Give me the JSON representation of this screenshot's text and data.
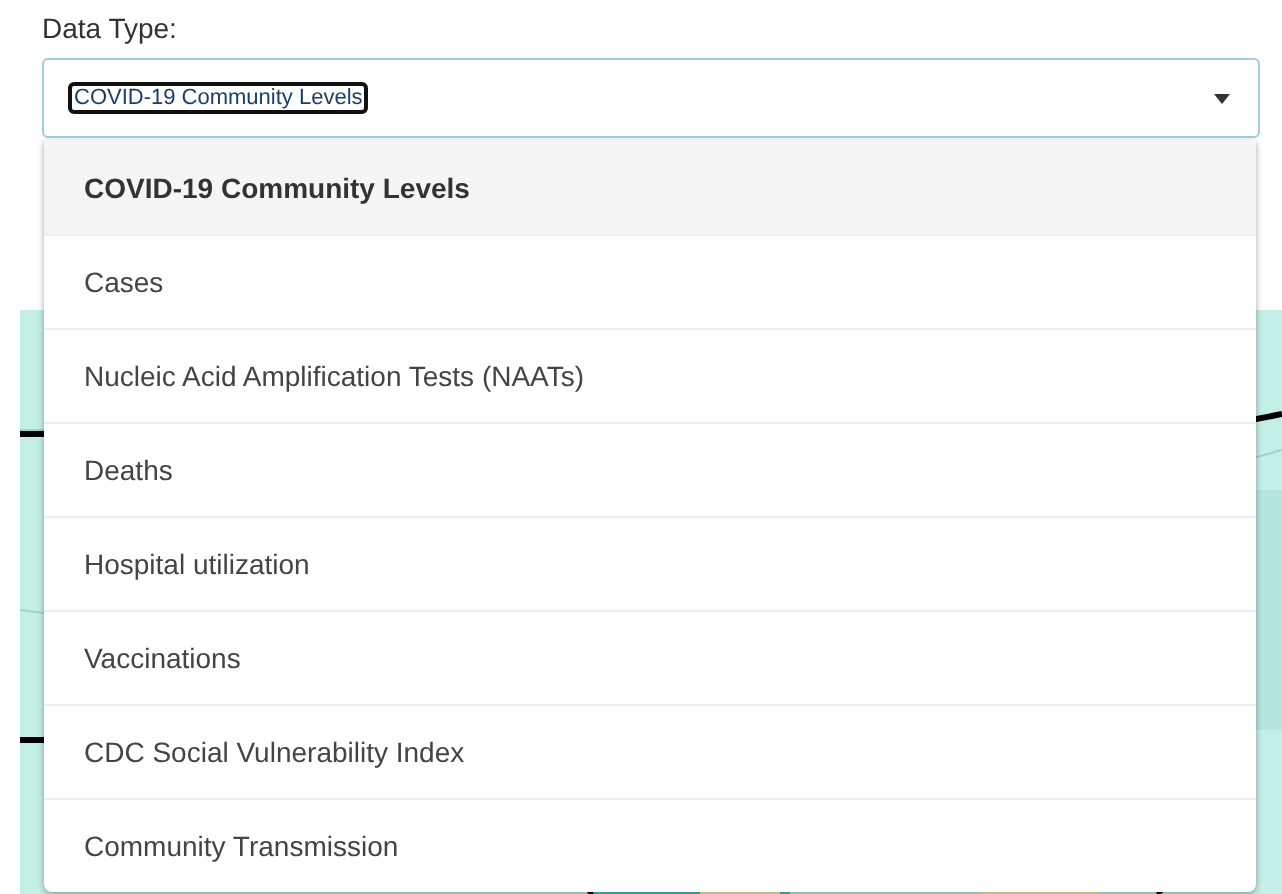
{
  "field": {
    "label": "Data Type:",
    "value": "COVID-19 Community Levels"
  },
  "options": [
    {
      "label": "COVID-19 Community Levels",
      "selected": true
    },
    {
      "label": "Cases",
      "selected": false
    },
    {
      "label": "Nucleic Acid Amplification Tests (NAATs)",
      "selected": false
    },
    {
      "label": "Deaths",
      "selected": false
    },
    {
      "label": "Hospital utilization",
      "selected": false
    },
    {
      "label": "Vaccinations",
      "selected": false
    },
    {
      "label": "CDC Social Vulnerability Index",
      "selected": false
    },
    {
      "label": "Community Transmission",
      "selected": false
    }
  ]
}
